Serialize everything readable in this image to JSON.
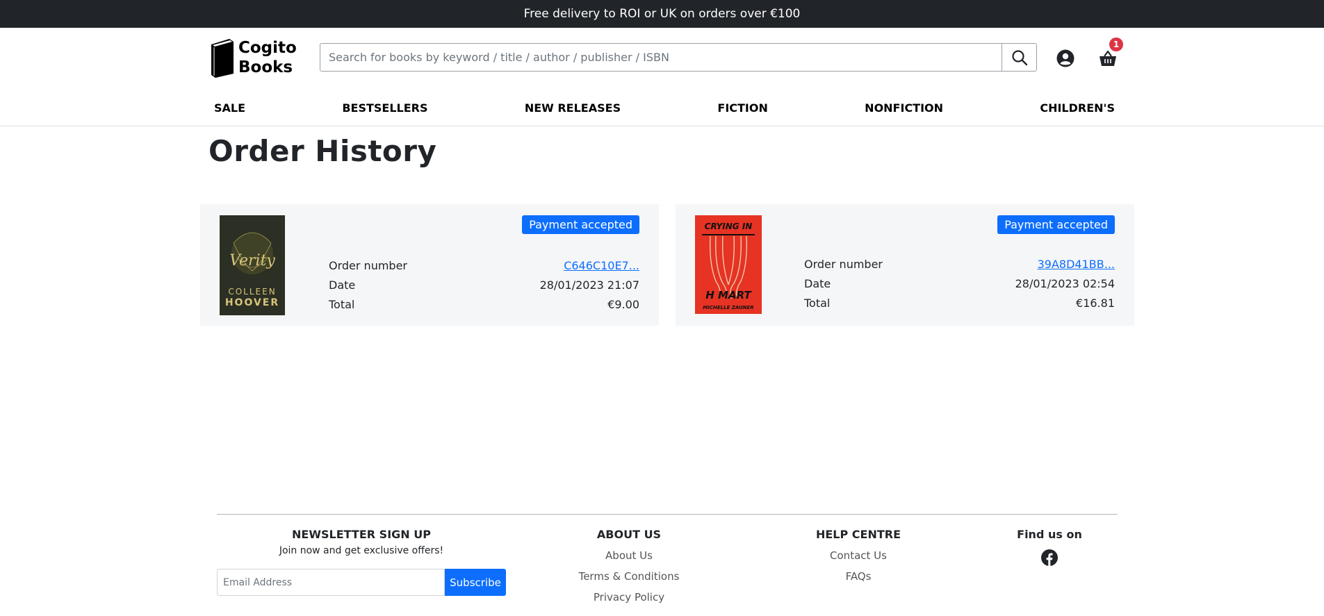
{
  "topbar": {
    "message": "Free delivery to ROI or UK on orders over €100"
  },
  "header": {
    "logo_line1": "Cogito",
    "logo_line2": "Books",
    "search_placeholder": "Search for books by keyword / title / author / publisher / ISBN",
    "cart_count": "1"
  },
  "nav": [
    "SALE",
    "BESTSELLERS",
    "NEW RELEASES",
    "FICTION",
    "NONFICTION",
    "CHILDREN'S"
  ],
  "page": {
    "title": "Order History"
  },
  "orders": [
    {
      "status": "Payment accepted",
      "order_number_label": "Order number",
      "order_number": "C646C10E7...",
      "date_label": "Date",
      "date": "28/01/2023 21:07",
      "total_label": "Total",
      "total": "€9.00",
      "cover": {
        "title": "Verity",
        "author_line1": "COLLEEN",
        "author_line2": "HOOVER",
        "bg": "#2b2f24",
        "accent": "#c9b46a"
      }
    },
    {
      "status": "Payment accepted",
      "order_number_label": "Order number",
      "order_number": "39A8D41BB...",
      "date_label": "Date",
      "date": "28/01/2023 02:54",
      "total_label": "Total",
      "total": "€16.81",
      "cover": {
        "title_top": "CRYING IN",
        "title_bottom": "H MART",
        "author": "MICHELLE ZAUNER",
        "bg": "#e63323",
        "accent": "#f0c0a0"
      }
    }
  ],
  "footer": {
    "newsletter": {
      "heading": "NEWSLETTER SIGN UP",
      "subtext": "Join now and get exclusive offers!",
      "placeholder": "Email Address",
      "button": "Subscribe"
    },
    "about": {
      "heading": "ABOUT US",
      "links": [
        "About Us",
        "Terms & Conditions",
        "Privacy Policy"
      ]
    },
    "help": {
      "heading": "HELP CENTRE",
      "links": [
        "Contact Us",
        "FAQs"
      ]
    },
    "social": {
      "heading": "Find us on",
      "icon": "facebook-icon"
    }
  },
  "colors": {
    "primary": "#0d6efd",
    "dark": "#212529",
    "badge": "#dc3545",
    "card_bg": "#f5f6f8"
  }
}
